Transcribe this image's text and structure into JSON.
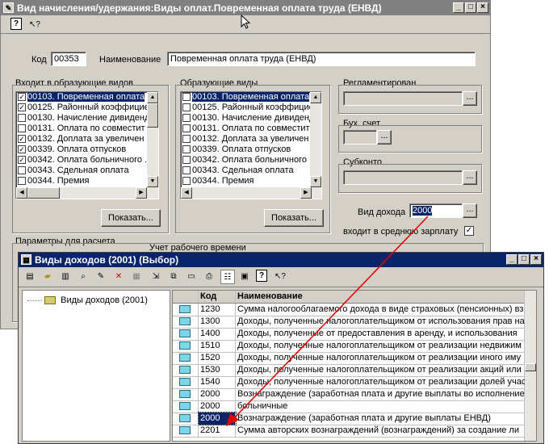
{
  "main": {
    "title": "Вид начисления/удержания:Виды оплат.Повременная оплата труда (ЕНВД)",
    "toolbar_help": "?",
    "code_label": "Код",
    "code_value": "00353",
    "name_label": "Наименование",
    "name_value": "Повременная оплата труда (ЕНВД)",
    "included_label": "Входит в образующие видов",
    "forming_label": "Образующие виды",
    "regulated_label": "Регламентирован",
    "account_label": "Бух. счет",
    "subconto_label": "Субконто",
    "income_type_label": "Вид дохода",
    "income_type_value": "2000",
    "avg_salary_label": "входит в среднюю зарплату",
    "show_button": "Показать...",
    "params_label": "Параметры для расчета",
    "work_time_label": "Учет рабочего времени",
    "ellipsis": "...",
    "list_left": [
      {
        "text": "00103. Повременная оплата",
        "checked": "✓"
      },
      {
        "text": "00125. Районный коэффицие",
        "checked": "✓"
      },
      {
        "text": "00130. Начисление дивиденд",
        "checked": ""
      },
      {
        "text": "00131. Оплата по совместит",
        "checked": ""
      },
      {
        "text": "00132. Доплата за увеличен",
        "checked": "✓"
      },
      {
        "text": "00339. Оплата отпусков",
        "checked": "✓"
      },
      {
        "text": "00342. Оплата больничного .",
        "checked": "✓"
      },
      {
        "text": "00343. Сдельная оплата",
        "checked": ""
      },
      {
        "text": "00344. Премия",
        "checked": ""
      }
    ],
    "list_right": [
      {
        "text": "00103. Повременная оплата",
        "checked": ""
      },
      {
        "text": "00125. Районный коэффицие",
        "checked": ""
      },
      {
        "text": "00130. Начисление дивиденд",
        "checked": ""
      },
      {
        "text": "00131. Оплата по совместит",
        "checked": ""
      },
      {
        "text": "00132. Доплата за увеличен",
        "checked": ""
      },
      {
        "text": "00339. Оплата отпусков",
        "checked": ""
      },
      {
        "text": "00342. Оплата больничного .",
        "checked": ""
      },
      {
        "text": "00343. Сдельная оплата",
        "checked": ""
      },
      {
        "text": "00344. Премия",
        "checked": ""
      }
    ]
  },
  "dialog": {
    "title": "Виды доходов (2001) (Выбор)",
    "tree_root": "Виды доходов (2001)",
    "col_code": "Код",
    "col_name": "Наименование",
    "rows": [
      {
        "code": "1230",
        "name": "Сумма налогооблагаемого дохода в виде страховых (пенсионных) вз"
      },
      {
        "code": "1300",
        "name": "Доходы, полученные налогоплательщиком от использования прав на"
      },
      {
        "code": "1400",
        "name": "Доходы, полученные от предоставления в аренду, и использования"
      },
      {
        "code": "1510",
        "name": "Доходы, полученные налогоплательщиком от реализации недвижим"
      },
      {
        "code": "1520",
        "name": "Доходы, полученные налогоплательщиком от реализации иного иму"
      },
      {
        "code": "1530",
        "name": "Доходы, полученные налогоплательщиком от реализации акций или"
      },
      {
        "code": "1540",
        "name": "Доходы, полученные налогоплательщиком от реализации долей учас"
      },
      {
        "code": "2000",
        "name": "Вознаграждение (заработная плата и другие выплаты во исполнение"
      },
      {
        "code": "2000",
        "name": "больничные"
      },
      {
        "code": "2000",
        "name": "Вознаграждение (заработная плата и другие выплаты ЕНВД)"
      },
      {
        "code": "2201",
        "name": "Сумма авторских вознаграждений (вознаграждений) за создание ли"
      }
    ]
  },
  "colors": {
    "active_title": "#0a246a",
    "inactive_title": "#808080",
    "arrow": "#e00000"
  }
}
